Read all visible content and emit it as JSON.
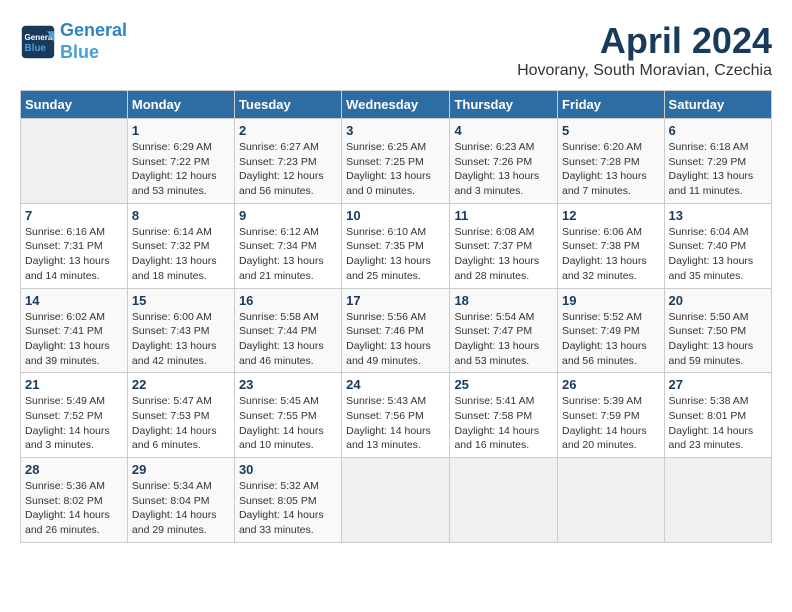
{
  "header": {
    "logo_line1": "General",
    "logo_line2": "Blue",
    "title": "April 2024",
    "subtitle": "Hovorany, South Moravian, Czechia"
  },
  "calendar": {
    "weekdays": [
      "Sunday",
      "Monday",
      "Tuesday",
      "Wednesday",
      "Thursday",
      "Friday",
      "Saturday"
    ],
    "weeks": [
      [
        {
          "day": "",
          "info": ""
        },
        {
          "day": "1",
          "info": "Sunrise: 6:29 AM\nSunset: 7:22 PM\nDaylight: 12 hours\nand 53 minutes."
        },
        {
          "day": "2",
          "info": "Sunrise: 6:27 AM\nSunset: 7:23 PM\nDaylight: 12 hours\nand 56 minutes."
        },
        {
          "day": "3",
          "info": "Sunrise: 6:25 AM\nSunset: 7:25 PM\nDaylight: 13 hours\nand 0 minutes."
        },
        {
          "day": "4",
          "info": "Sunrise: 6:23 AM\nSunset: 7:26 PM\nDaylight: 13 hours\nand 3 minutes."
        },
        {
          "day": "5",
          "info": "Sunrise: 6:20 AM\nSunset: 7:28 PM\nDaylight: 13 hours\nand 7 minutes."
        },
        {
          "day": "6",
          "info": "Sunrise: 6:18 AM\nSunset: 7:29 PM\nDaylight: 13 hours\nand 11 minutes."
        }
      ],
      [
        {
          "day": "7",
          "info": "Sunrise: 6:16 AM\nSunset: 7:31 PM\nDaylight: 13 hours\nand 14 minutes."
        },
        {
          "day": "8",
          "info": "Sunrise: 6:14 AM\nSunset: 7:32 PM\nDaylight: 13 hours\nand 18 minutes."
        },
        {
          "day": "9",
          "info": "Sunrise: 6:12 AM\nSunset: 7:34 PM\nDaylight: 13 hours\nand 21 minutes."
        },
        {
          "day": "10",
          "info": "Sunrise: 6:10 AM\nSunset: 7:35 PM\nDaylight: 13 hours\nand 25 minutes."
        },
        {
          "day": "11",
          "info": "Sunrise: 6:08 AM\nSunset: 7:37 PM\nDaylight: 13 hours\nand 28 minutes."
        },
        {
          "day": "12",
          "info": "Sunrise: 6:06 AM\nSunset: 7:38 PM\nDaylight: 13 hours\nand 32 minutes."
        },
        {
          "day": "13",
          "info": "Sunrise: 6:04 AM\nSunset: 7:40 PM\nDaylight: 13 hours\nand 35 minutes."
        }
      ],
      [
        {
          "day": "14",
          "info": "Sunrise: 6:02 AM\nSunset: 7:41 PM\nDaylight: 13 hours\nand 39 minutes."
        },
        {
          "day": "15",
          "info": "Sunrise: 6:00 AM\nSunset: 7:43 PM\nDaylight: 13 hours\nand 42 minutes."
        },
        {
          "day": "16",
          "info": "Sunrise: 5:58 AM\nSunset: 7:44 PM\nDaylight: 13 hours\nand 46 minutes."
        },
        {
          "day": "17",
          "info": "Sunrise: 5:56 AM\nSunset: 7:46 PM\nDaylight: 13 hours\nand 49 minutes."
        },
        {
          "day": "18",
          "info": "Sunrise: 5:54 AM\nSunset: 7:47 PM\nDaylight: 13 hours\nand 53 minutes."
        },
        {
          "day": "19",
          "info": "Sunrise: 5:52 AM\nSunset: 7:49 PM\nDaylight: 13 hours\nand 56 minutes."
        },
        {
          "day": "20",
          "info": "Sunrise: 5:50 AM\nSunset: 7:50 PM\nDaylight: 13 hours\nand 59 minutes."
        }
      ],
      [
        {
          "day": "21",
          "info": "Sunrise: 5:49 AM\nSunset: 7:52 PM\nDaylight: 14 hours\nand 3 minutes."
        },
        {
          "day": "22",
          "info": "Sunrise: 5:47 AM\nSunset: 7:53 PM\nDaylight: 14 hours\nand 6 minutes."
        },
        {
          "day": "23",
          "info": "Sunrise: 5:45 AM\nSunset: 7:55 PM\nDaylight: 14 hours\nand 10 minutes."
        },
        {
          "day": "24",
          "info": "Sunrise: 5:43 AM\nSunset: 7:56 PM\nDaylight: 14 hours\nand 13 minutes."
        },
        {
          "day": "25",
          "info": "Sunrise: 5:41 AM\nSunset: 7:58 PM\nDaylight: 14 hours\nand 16 minutes."
        },
        {
          "day": "26",
          "info": "Sunrise: 5:39 AM\nSunset: 7:59 PM\nDaylight: 14 hours\nand 20 minutes."
        },
        {
          "day": "27",
          "info": "Sunrise: 5:38 AM\nSunset: 8:01 PM\nDaylight: 14 hours\nand 23 minutes."
        }
      ],
      [
        {
          "day": "28",
          "info": "Sunrise: 5:36 AM\nSunset: 8:02 PM\nDaylight: 14 hours\nand 26 minutes."
        },
        {
          "day": "29",
          "info": "Sunrise: 5:34 AM\nSunset: 8:04 PM\nDaylight: 14 hours\nand 29 minutes."
        },
        {
          "day": "30",
          "info": "Sunrise: 5:32 AM\nSunset: 8:05 PM\nDaylight: 14 hours\nand 33 minutes."
        },
        {
          "day": "",
          "info": ""
        },
        {
          "day": "",
          "info": ""
        },
        {
          "day": "",
          "info": ""
        },
        {
          "day": "",
          "info": ""
        }
      ]
    ]
  }
}
